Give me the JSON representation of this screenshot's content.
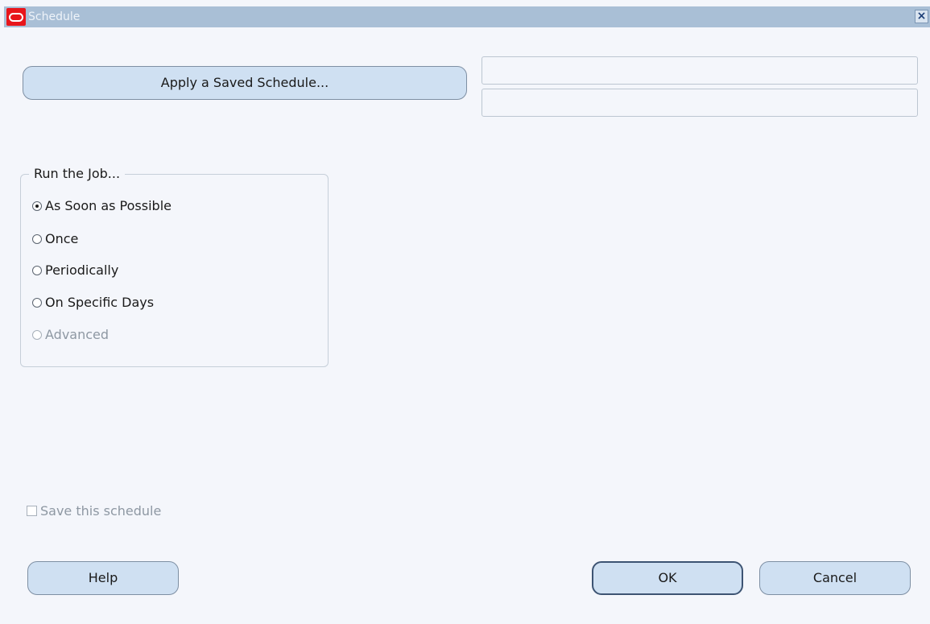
{
  "window": {
    "title": "Schedule",
    "close_icon": "close-icon"
  },
  "apply_saved_schedule": {
    "label": "Apply a Saved Schedule..."
  },
  "schedule_fields": {
    "field1_value": "",
    "field2_value": ""
  },
  "run_group": {
    "label": "Run the Job...",
    "options": [
      {
        "label": "As Soon as Possible",
        "selected": true,
        "enabled": true
      },
      {
        "label": "Once",
        "selected": false,
        "enabled": true
      },
      {
        "label": "Periodically",
        "selected": false,
        "enabled": true
      },
      {
        "label": "On Specific Days",
        "selected": false,
        "enabled": true
      },
      {
        "label": "Advanced",
        "selected": false,
        "enabled": false
      }
    ]
  },
  "save_schedule": {
    "label": "Save this schedule",
    "checked": false,
    "enabled": false
  },
  "buttons": {
    "help": "Help",
    "ok": "OK",
    "cancel": "Cancel"
  },
  "colors": {
    "titlebar": "#a9bfd6",
    "button_fill": "#cfe0f2",
    "background": "#f4f6fb",
    "oracle_red": "#e8151b"
  }
}
